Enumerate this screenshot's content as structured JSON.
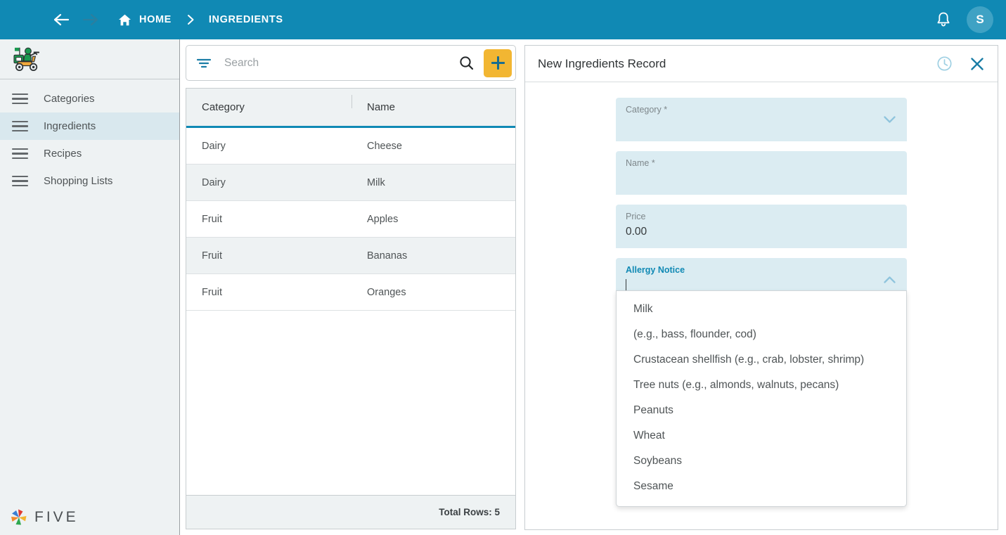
{
  "topbar": {
    "menu_icon": "hamburger-menu-icon",
    "back_icon": "arrow-back-icon",
    "forward_icon": "arrow-forward-icon",
    "home_icon": "home-icon",
    "home_label": "HOME",
    "separator_icon": "chevron-right-icon",
    "breadcrumb_current": "INGREDIENTS",
    "notifications_icon": "bell-icon",
    "avatar_initial": "S",
    "background_color": "#1089b4",
    "avatar_color": "#3fa2c4"
  },
  "sidebar": {
    "logo_icon": "delivery-scooter-logo",
    "items": [
      {
        "label": "Categories",
        "icon": "list-icon",
        "active": false
      },
      {
        "label": "Ingredients",
        "icon": "list-icon",
        "active": true
      },
      {
        "label": "Recipes",
        "icon": "list-icon",
        "active": false
      },
      {
        "label": "Shopping Lists",
        "icon": "list-icon",
        "active": false
      }
    ],
    "footer_logo_icon": "five-pinwheel-logo",
    "footer_logo_text": "FIVE",
    "active_color": "#d9e8ee"
  },
  "list_panel": {
    "search": {
      "filter_icon": "filter-icon",
      "placeholder": "Search",
      "value": "",
      "search_icon": "search-icon",
      "add_icon": "plus-icon",
      "add_button_color": "#f2b632"
    },
    "table": {
      "columns": [
        "Category",
        "Name"
      ],
      "rows": [
        {
          "category": "Dairy",
          "name": "Cheese"
        },
        {
          "category": "Dairy",
          "name": "Milk"
        },
        {
          "category": "Fruit",
          "name": "Apples"
        },
        {
          "category": "Fruit",
          "name": "Bananas"
        },
        {
          "category": "Fruit",
          "name": "Oranges"
        }
      ],
      "footer": "Total Rows: 5",
      "header_accent_color": "#1089b4"
    }
  },
  "form_panel": {
    "title": "New Ingredients Record",
    "history_icon": "clock-history-icon",
    "close_icon": "close-x-icon",
    "fields": [
      {
        "label": "Category *",
        "value": "",
        "type": "select",
        "chevron": "chevron-down-icon",
        "active": false
      },
      {
        "label": "Name *",
        "value": "",
        "type": "text",
        "active": false
      },
      {
        "label": "Price",
        "value": "0.00",
        "type": "text",
        "active": false
      },
      {
        "label": "Allergy Notice",
        "value": "",
        "type": "select",
        "chevron": "chevron-up-icon",
        "active": true
      }
    ],
    "dropdown": {
      "open": true,
      "options": [
        "Milk",
        "(e.g., bass, flounder, cod)",
        "Crustacean shellfish (e.g., crab, lobster, shrimp)",
        "Tree nuts (e.g., almonds, walnuts, pecans)",
        "Peanuts",
        "Wheat",
        "Soybeans",
        "Sesame"
      ]
    },
    "field_background": "#dbecf2",
    "focus_color": "#1089b4"
  }
}
